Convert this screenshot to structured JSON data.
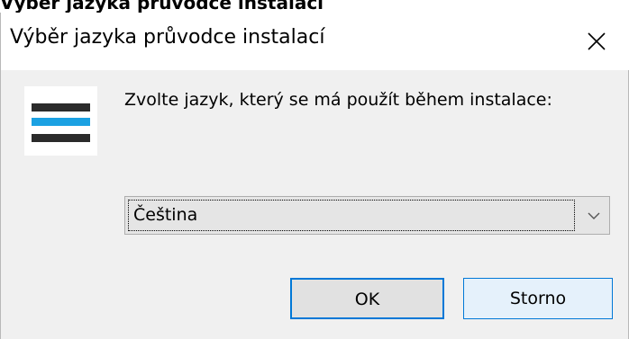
{
  "window": {
    "title": "Výběr jazyka průvodce instalací",
    "clipped_fragment": "Výběr jazyka průvodce instalací"
  },
  "icons": {
    "close": "close-icon",
    "logo": "setup-logo-icon",
    "dropdown": "chevron-down-icon"
  },
  "logo": {
    "bar_colors": [
      "#2b2b2b",
      "#1ba1e2",
      "#2b2b2b"
    ]
  },
  "prompt": {
    "text": "Zvolte jazyk, který se má použít během instalace:"
  },
  "language_select": {
    "selected": "Čeština"
  },
  "buttons": {
    "ok": "OK",
    "cancel": "Storno"
  },
  "colors": {
    "accent": "#0078d7",
    "dialog_bg": "#f0f0f0",
    "titlebar_bg": "#ffffff"
  }
}
